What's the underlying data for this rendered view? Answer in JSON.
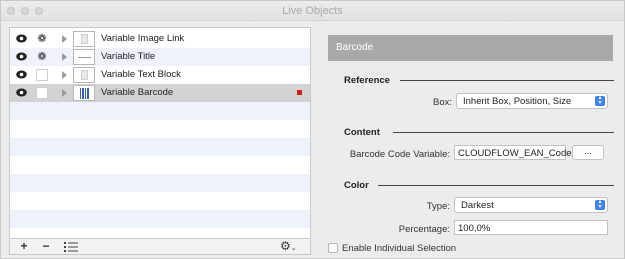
{
  "window": {
    "title": "Live Objects"
  },
  "layers": [
    {
      "label": "Variable Image Link",
      "visible": true,
      "locked": true,
      "thumb_icon": "image-thumbnail-icon"
    },
    {
      "label": "Variable Title",
      "visible": true,
      "locked": true,
      "thumb_icon": "text-line-thumbnail-icon"
    },
    {
      "label": "Variable Text Block",
      "visible": true,
      "locked": false,
      "thumb_icon": "text-block-thumbnail-icon"
    },
    {
      "label": "Variable Barcode",
      "visible": true,
      "locked": false,
      "selected": true,
      "marker_color": "#e01818",
      "thumb_icon": "barcode-thumbnail-icon"
    }
  ],
  "bottom_bar": {
    "add": "+",
    "remove": "−",
    "list_icon": "list-icon",
    "gear_icon": "gear-menu-icon"
  },
  "panel": {
    "header": "Barcode",
    "reference": {
      "section": "Reference",
      "box_label": "Box:",
      "box_value": "Inherit Box, Position, Size"
    },
    "content": {
      "section": "Content",
      "variable_label": "Barcode Code Variable:",
      "variable_value": "CLOUDFLOW_EAN_Code",
      "browse_label": "..."
    },
    "color": {
      "section": "Color",
      "type_label": "Type:",
      "type_value": "Darkest",
      "percentage_label": "Percentage:",
      "percentage_value": "100,0%"
    },
    "individual_selection_label": "Enable Individual Selection"
  },
  "colors": {
    "accent": "#3b82f6",
    "header_bg": "#a9a9a9",
    "selected_row": "#d3d3d3",
    "alt_row": "#eef2fa"
  }
}
